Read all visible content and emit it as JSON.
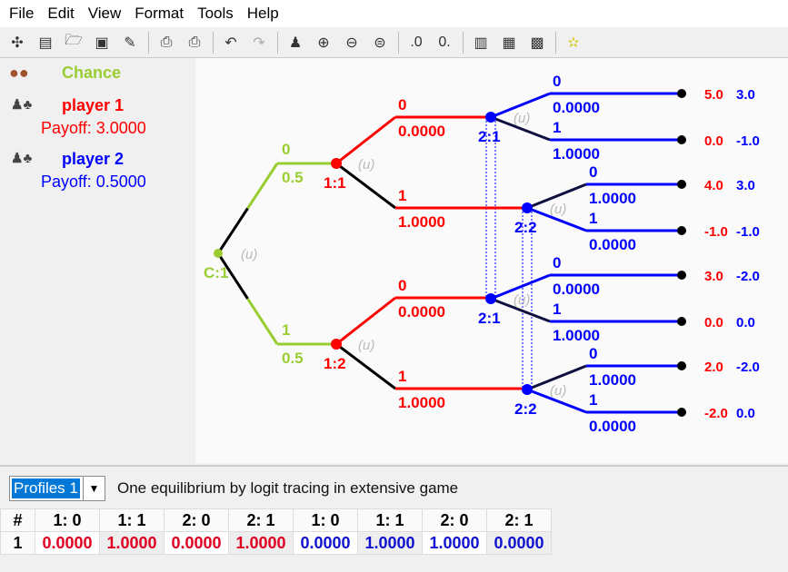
{
  "menu": [
    "File",
    "Edit",
    "View",
    "Format",
    "Tools",
    "Help"
  ],
  "toolbar": [
    "about-icon",
    "new-icon",
    "open-icon",
    "save-icon",
    "save-as-icon",
    "print-icon",
    "print-preview-icon",
    "undo-icon",
    "redo-icon",
    "add-player-icon",
    "zoom-in-icon",
    "zoom-out-icon",
    "zoom-fit-icon",
    "decimals-add-icon",
    "decimals-remove-icon",
    "profiles-icon",
    "strategic-form-icon",
    "calculator-icon",
    "equilibrium-icon"
  ],
  "players": [
    {
      "name": "Chance",
      "color": "#9acd32"
    },
    {
      "name": "player 1",
      "payoff": "Payoff: 3.0000",
      "color": "#ff0000"
    },
    {
      "name": "player 2",
      "payoff": "Payoff: 0.5000",
      "color": "#0000ff"
    }
  ],
  "tree": {
    "root": {
      "label": "C:1",
      "branches": [
        {
          "action": "0",
          "prob": "0.5"
        },
        {
          "action": "1",
          "prob": "0.5"
        }
      ]
    },
    "p1_nodes": [
      {
        "label": "1:1",
        "branches": [
          {
            "action": "0",
            "prob": "0.0000"
          },
          {
            "action": "1",
            "prob": "1.0000"
          }
        ]
      },
      {
        "label": "1:2",
        "branches": [
          {
            "action": "0",
            "prob": "0.0000"
          },
          {
            "action": "1",
            "prob": "1.0000"
          }
        ]
      }
    ],
    "p2_nodes": [
      {
        "label": "2:1",
        "branches": [
          {
            "action": "0",
            "prob": "0.0000"
          },
          {
            "action": "1",
            "prob": "1.0000"
          }
        ]
      },
      {
        "label": "2:2",
        "branches": [
          {
            "action": "0",
            "prob": "1.0000"
          },
          {
            "action": "1",
            "prob": "0.0000"
          }
        ]
      },
      {
        "label": "2:1",
        "branches": [
          {
            "action": "0",
            "prob": "0.0000"
          },
          {
            "action": "1",
            "prob": "1.0000"
          }
        ]
      },
      {
        "label": "2:2",
        "branches": [
          {
            "action": "0",
            "prob": "1.0000"
          },
          {
            "action": "1",
            "prob": "0.0000"
          }
        ]
      }
    ],
    "belief": "(u)",
    "payoffs": [
      [
        "5.0",
        "3.0"
      ],
      [
        "0.0",
        "-1.0"
      ],
      [
        "4.0",
        "3.0"
      ],
      [
        "-1.0",
        "-1.0"
      ],
      [
        "3.0",
        "-2.0"
      ],
      [
        "0.0",
        "0.0"
      ],
      [
        "2.0",
        "-2.0"
      ],
      [
        "-2.0",
        "0.0"
      ]
    ]
  },
  "profiles": {
    "selected": "Profiles 1",
    "description": "One equilibrium by logit tracing in extensive game",
    "headers": [
      "#",
      "1: 0",
      "1: 1",
      "2: 0",
      "2: 1",
      "1: 0",
      "1: 1",
      "2: 0",
      "2: 1"
    ],
    "rows": [
      [
        "1",
        "0.0000",
        "1.0000",
        "0.0000",
        "1.0000",
        "0.0000",
        "1.0000",
        "1.0000",
        "0.0000"
      ]
    ]
  }
}
